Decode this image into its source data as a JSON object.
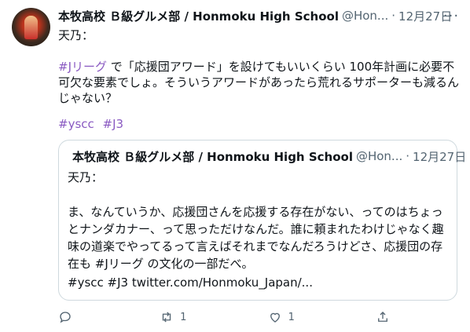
{
  "tweet": {
    "author_name": "本牧高校 Ｂ級グルメ部 / Honmoku High School",
    "handle": "@Hon...",
    "dot": "·",
    "date": "12月27日",
    "more": "···",
    "text_prefix": "天乃：\n\n",
    "hashtag_inline": "#Jリーグ",
    "text_body": " で「応援団アワード」を設けてもいいくらい 100年計画に必要不可欠な要素でしょ。そういうアワードがあったら荒れるサポーターも減るんじゃない？",
    "tags": [
      "#yscc",
      "#J3"
    ]
  },
  "quote": {
    "author_name": "本牧高校 Ｂ級グルメ部 / Honmoku High School",
    "handle": "@Hon...",
    "dot": "·",
    "date": "12月27日",
    "text_prefix": "天乃：\n\nま、なんていうか、応援団さんを応援する存在がない、ってのはちょっとナンダカナー、って思っただけなんだ。誰に頼まれたわけじゃなく趣味の道楽でやってるって言えばそれまでなんだろうけどさ、応援団の存在も ",
    "hashtag_inline": "#Jリーグ",
    "text_suffix": " の文化の一部だべ。",
    "link_line": "#yscc #J3 twitter.com/Honmoku_Japan/..."
  },
  "actions": {
    "reply_count": "",
    "retweet_count": "1",
    "like_count": "1",
    "share_count": ""
  },
  "colors": {
    "hashtag": "#8a5ac2",
    "muted": "#536471",
    "border": "#cfd9de"
  }
}
